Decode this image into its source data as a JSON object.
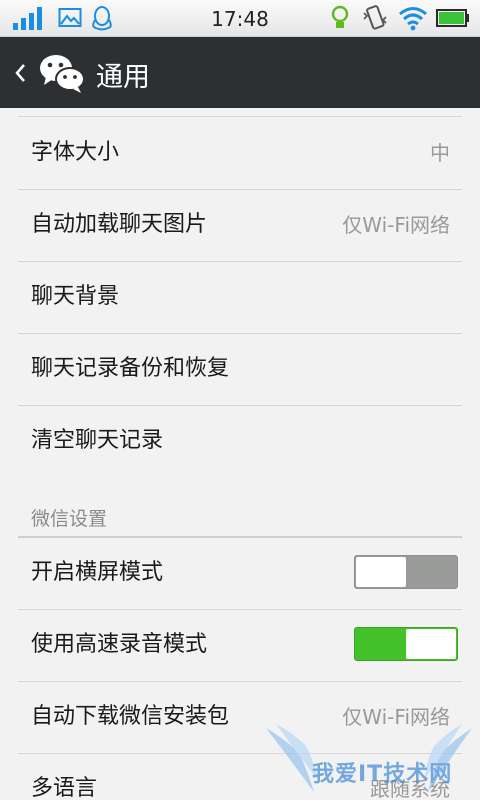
{
  "status_bar": {
    "time": "17:48",
    "icons": [
      "signal-bars-icon",
      "image-notification-icon",
      "qq-penguin-icon",
      "lightbulb-icon",
      "vibrate-icon",
      "wifi-icon",
      "battery-icon"
    ],
    "accent": "#1a8fe0",
    "battery_color": "#39c23a"
  },
  "action_bar": {
    "back_icon": "chevron-left-icon",
    "logo_icon": "wechat-logo-icon",
    "title": "通用",
    "background": "#2d3033"
  },
  "rows": [
    {
      "label": "字体大小",
      "value": "中"
    },
    {
      "label": "自动加载聊天图片",
      "value": "仅Wi-Fi网络"
    },
    {
      "label": "聊天背景",
      "value": ""
    },
    {
      "label": "聊天记录备份和恢复",
      "value": ""
    },
    {
      "label": "清空聊天记录",
      "value": ""
    }
  ],
  "section_wechat": {
    "header": "微信设置",
    "rows": [
      {
        "label": "开启横屏模式",
        "toggle": false
      },
      {
        "label": "使用高速录音模式",
        "toggle": true
      },
      {
        "label": "自动下载微信安装包",
        "value": "仅Wi-Fi网络"
      },
      {
        "label": "多语言",
        "value": "跟随系统"
      }
    ]
  },
  "watermark": {
    "text": "我爱IT技术网"
  },
  "colors": {
    "toggle_on": "#44c12a",
    "toggle_off": "#999b98",
    "value_text": "#999999"
  }
}
